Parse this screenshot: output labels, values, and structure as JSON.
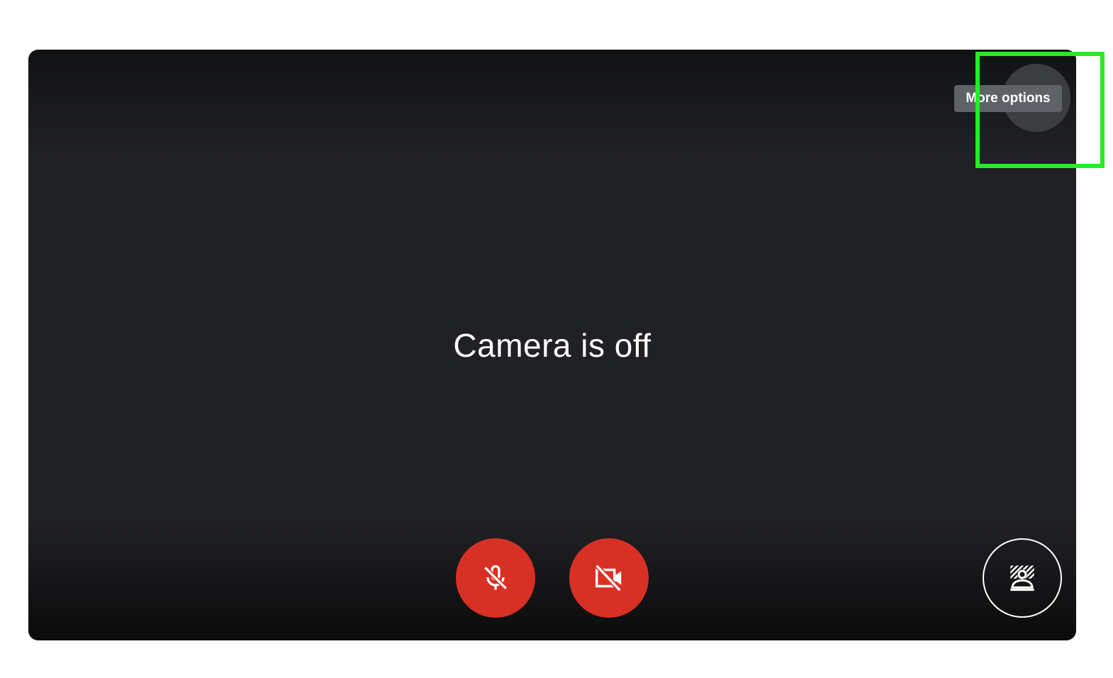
{
  "preview": {
    "status_text": "Camera is off"
  },
  "controls": {
    "mic": {
      "icon": "mic-off-icon",
      "state": "off",
      "color": "#d93025"
    },
    "camera": {
      "icon": "videocam-off-icon",
      "state": "off",
      "color": "#d93025"
    },
    "effects": {
      "icon": "visual-effects-icon"
    }
  },
  "more_options": {
    "icon": "more-vert-icon",
    "tooltip": "More options"
  },
  "highlight_color": "#22ee22"
}
